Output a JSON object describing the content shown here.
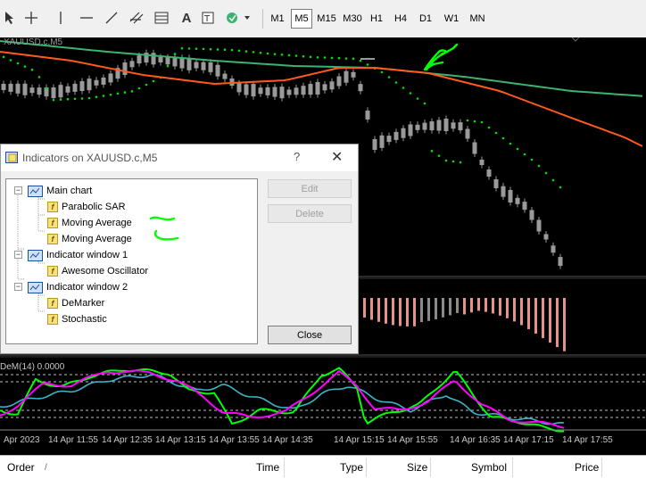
{
  "toolbar": {
    "timeframes": [
      "M1",
      "M5",
      "M15",
      "M30",
      "H1",
      "H4",
      "D1",
      "W1",
      "MN"
    ],
    "active_timeframe": "M5",
    "tools": [
      "cursor-icon",
      "crosshair-icon",
      "vertical-line-icon",
      "horizontal-line-icon",
      "trendline-icon",
      "channel-icon",
      "fibonacci-icon",
      "text-icon",
      "label-icon",
      "shapes-dropdown-icon"
    ]
  },
  "chart": {
    "symbol_label": "XAUUSD.c,M5",
    "dem_label": "DeM(14) 0.0000",
    "time_labels": [
      "Apr 2023",
      "14 Apr 11:55",
      "14 Apr 12:35",
      "14 Apr 13:15",
      "14 Apr 13:55",
      "14 Apr 14:35",
      "14 Apr 15:15",
      "14 Apr 15:55",
      "14 Apr 16:35",
      "14 Apr 17:15",
      "14 Apr 17:55"
    ],
    "colors": {
      "background": "#000000",
      "candle": "#9a9a9a",
      "sar_dots": "#00e000",
      "ma_fast": "#ff5a1e",
      "ma_slow": "#3cb371",
      "ao_bars": "#e69189",
      "ao_bars_up": "#8a8a8a",
      "demarker": "#00ff00",
      "stoch_main": "#ff00ff",
      "stoch_signal": "#3cb4c8"
    }
  },
  "dialog": {
    "title": "Indicators on XAUUSD.c,M5",
    "help_glyph": "?",
    "close_glyph": "✕",
    "tree": [
      {
        "label": "Main chart",
        "type": "window",
        "level": 0
      },
      {
        "label": "Parabolic SAR",
        "type": "indicator",
        "level": 1
      },
      {
        "label": "Moving Average",
        "type": "indicator",
        "level": 1
      },
      {
        "label": "Moving Average",
        "type": "indicator",
        "level": 1
      },
      {
        "label": "Indicator window 1",
        "type": "window",
        "level": 0
      },
      {
        "label": "Awesome Oscillator",
        "type": "indicator",
        "level": 1
      },
      {
        "label": "Indicator window 2",
        "type": "window",
        "level": 0
      },
      {
        "label": "DeMarker",
        "type": "indicator",
        "level": 1
      },
      {
        "label": "Stochastic",
        "type": "indicator",
        "level": 1
      }
    ],
    "buttons": {
      "edit": "Edit",
      "delete": "Delete",
      "close": "Close"
    }
  },
  "terminal": {
    "columns": [
      "Order",
      "/",
      "Time",
      "Type",
      "Size",
      "Symbol",
      "Price"
    ]
  }
}
